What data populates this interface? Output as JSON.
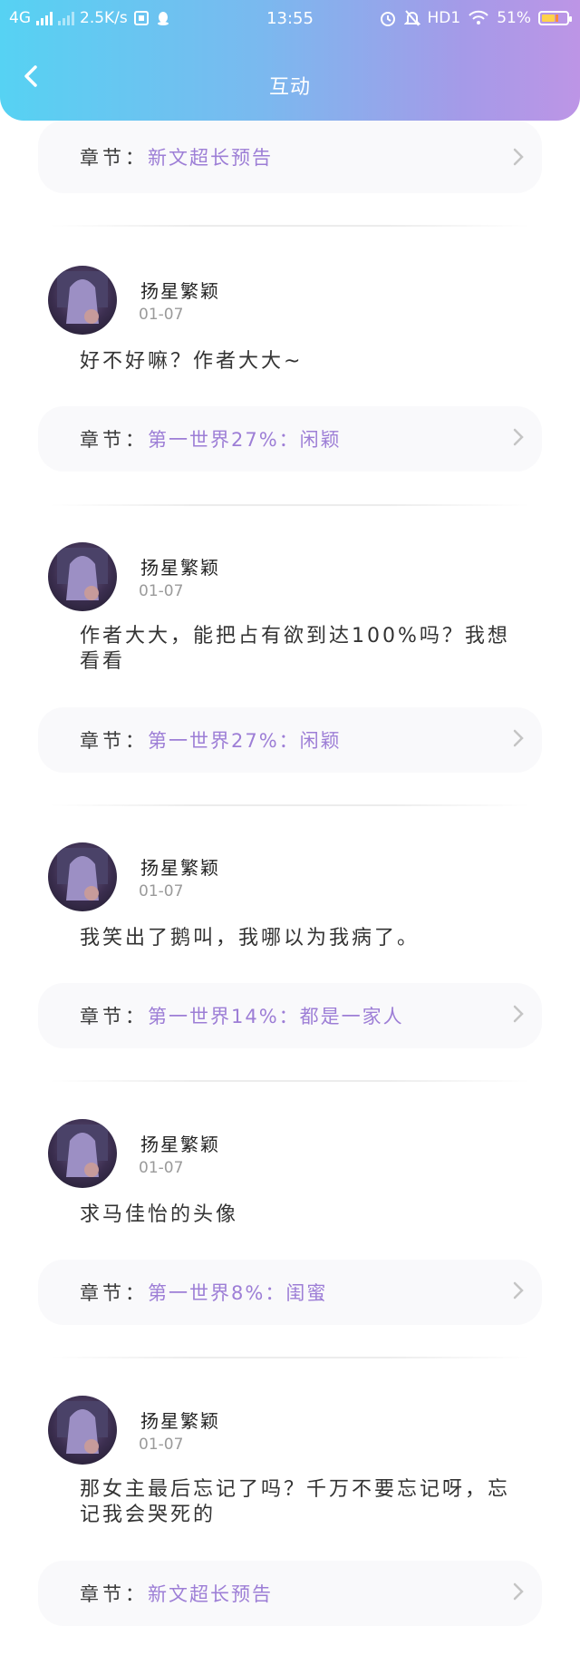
{
  "status_bar": {
    "network": "4G",
    "speed": "2.5K/s",
    "time": "13:55",
    "hd": "HD1",
    "battery": "51%"
  },
  "nav": {
    "title": "互动"
  },
  "chapter_label": "章节：",
  "first_chapter": "新文超长预告",
  "posts": [
    {
      "username": "扬星繁颖",
      "date": "01-07",
      "content": "好不好嘛？作者大大~",
      "chapter": "第一世界27%：闲颖"
    },
    {
      "username": "扬星繁颖",
      "date": "01-07",
      "content": "作者大大，能把占有欲到达100%吗？我想看看",
      "chapter": "第一世界27%：闲颖"
    },
    {
      "username": "扬星繁颖",
      "date": "01-07",
      "content": "我笑出了鹅叫，我哪以为我病了。",
      "chapter": "第一世界14%：都是一家人"
    },
    {
      "username": "扬星繁颖",
      "date": "01-07",
      "content": "求马佳怡的头像",
      "chapter": "第一世界8%：闺蜜"
    },
    {
      "username": "扬星繁颖",
      "date": "01-07",
      "content": "那女主最后忘记了吗？千万不要忘记呀，忘记我会哭死的",
      "chapter": "新文超长预告"
    }
  ]
}
